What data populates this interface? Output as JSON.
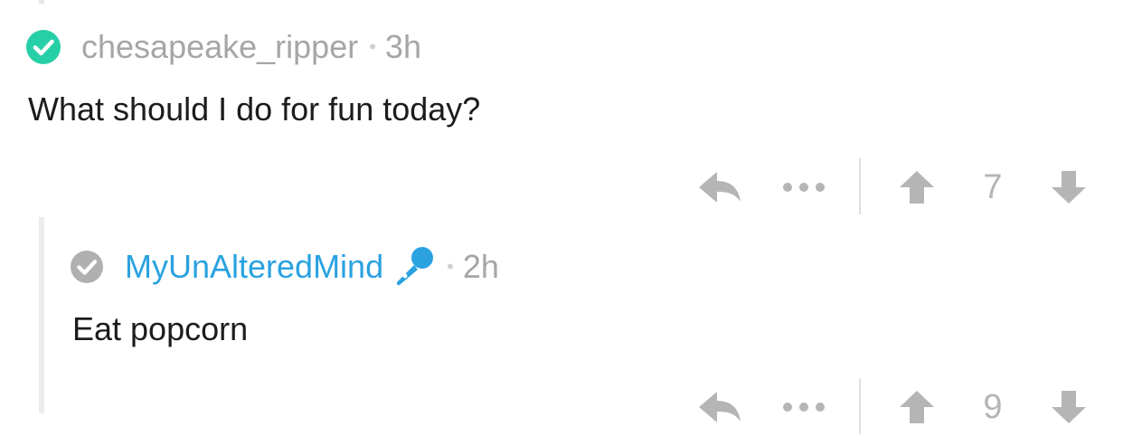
{
  "colors": {
    "verified_badge": "#27cfa7",
    "grey_badge": "#b0b0b0",
    "username_blue": "#2aa2e0",
    "muted": "#a6a6a6",
    "action_icon": "#b5b5b5"
  },
  "comments": [
    {
      "username": "chesapeake_ripper",
      "separator": "•",
      "time": "3h",
      "badge_icon": "verified-check-icon",
      "text": "What should I do for fun today?",
      "score": "7"
    },
    {
      "username": "MyUnAlteredMind",
      "flair_icon": "microphone-icon",
      "separator": "•",
      "time": "2h",
      "badge_icon": "grey-check-icon",
      "text": "Eat popcorn",
      "score": "9"
    }
  ]
}
